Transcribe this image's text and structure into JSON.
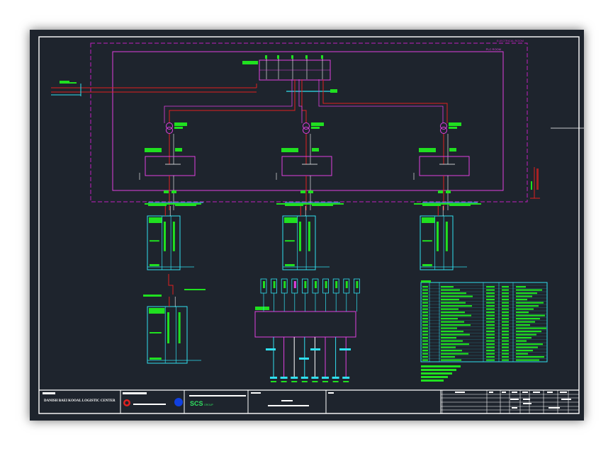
{
  "colors": {
    "background": "#1e242d",
    "border": "#ffffff",
    "boundary_room": "#c020c0",
    "ha_room": "#e040e0",
    "cable_red": "#e02020",
    "bus_cyan": "#30e0f0",
    "label_green": "#20e020",
    "red_logo": "#e02020",
    "blue_logo": "#1040e0",
    "scs_green": "#30e060"
  },
  "labels": {
    "room_outer": "ELECTRICAL ROOM",
    "room_inner": "PLC ROOM",
    "logo_text": "SCS",
    "logo_subtext": "GROUP",
    "client_name": "DANISH BAEI KOOAL LOGISTIC CENTER"
  },
  "title_block": {
    "drawing_label": "REF. NO."
  }
}
